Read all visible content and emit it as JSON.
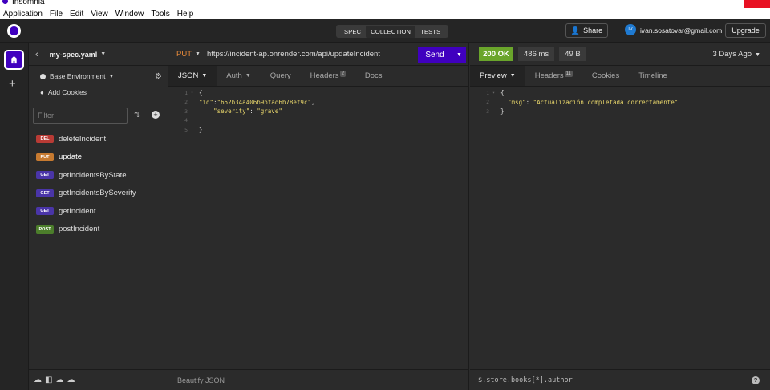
{
  "window": {
    "title": "Insomnia"
  },
  "menu": [
    "Application",
    "File",
    "Edit",
    "View",
    "Window",
    "Tools",
    "Help"
  ],
  "header": {
    "modes": [
      "SPEC",
      "COLLECTION",
      "TESTS"
    ],
    "active_mode": "COLLECTION",
    "share_label": "Share",
    "avatar_initials": "IV",
    "email": "ivan.sosatovar@gmail.com",
    "upgrade_label": "Upgrade"
  },
  "sidebar": {
    "spec_name": "my-spec.yaml",
    "environment": "Base Environment",
    "cookies_label": "Add Cookies",
    "filter_placeholder": "Filter",
    "requests": [
      {
        "method": "DEL",
        "name": "deleteIncident",
        "color": "#b93b35"
      },
      {
        "method": "PUT",
        "name": "update",
        "color": "#c77a30",
        "active": true
      },
      {
        "method": "GET",
        "name": "getIncidentsByState",
        "color": "#4a35a8"
      },
      {
        "method": "GET",
        "name": "getIncidentsBySeverity",
        "color": "#4a35a8"
      },
      {
        "method": "GET",
        "name": "getIncident",
        "color": "#4a35a8"
      },
      {
        "method": "POST",
        "name": "postIncident",
        "color": "#4c7e2b"
      }
    ]
  },
  "request": {
    "method": "PUT",
    "url": "https://incident-ap.onrender.com/api/updateIncident",
    "send_label": "Send",
    "tabs": [
      {
        "label": "JSON",
        "active": true,
        "dropdown": true
      },
      {
        "label": "Auth",
        "dropdown": true
      },
      {
        "label": "Query"
      },
      {
        "label": "Headers",
        "badge": "2"
      },
      {
        "label": "Docs"
      }
    ],
    "body_lines": [
      {
        "n": "1",
        "text": "{"
      },
      {
        "n": "2",
        "key": "\"id\"",
        "sep": ":",
        "val": "\"652b34a406b9bfad6b78ef9c\"",
        "tail": ","
      },
      {
        "n": "3",
        "indent": "    ",
        "key": "\"severity\"",
        "sep": ": ",
        "val": "\"grave\""
      },
      {
        "n": "4",
        "text": ""
      },
      {
        "n": "5",
        "text": "}"
      }
    ],
    "footer": "Beautify JSON"
  },
  "response": {
    "status": "200 OK",
    "time": "486 ms",
    "size": "49 B",
    "ago": "3 Days Ago",
    "tabs": [
      {
        "label": "Preview",
        "active": true,
        "dropdown": true
      },
      {
        "label": "Headers",
        "badge": "11"
      },
      {
        "label": "Cookies"
      },
      {
        "label": "Timeline"
      }
    ],
    "body_lines": [
      {
        "n": "1",
        "text": "{"
      },
      {
        "n": "2",
        "indent": "  ",
        "key": "\"msg\"",
        "sep": ": ",
        "val": "\"Actualización completada correctamente\""
      },
      {
        "n": "3",
        "text": "}"
      }
    ],
    "filter": "$.store.books[*].author",
    "help_label": "?"
  }
}
